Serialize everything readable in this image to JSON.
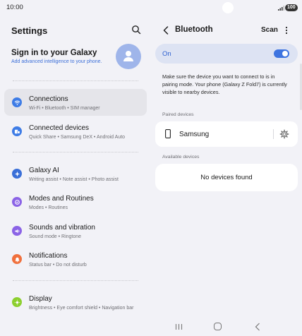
{
  "status": {
    "time": "10:00",
    "battery": "100"
  },
  "left": {
    "title": "Settings",
    "account": {
      "title": "Sign in to your Galaxy",
      "subtitle": "Add advanced intelligence to your phone."
    },
    "items": [
      {
        "title": "Connections",
        "sub": "Wi-Fi • Bluetooth • SIM manager",
        "icon": "wifi-icon",
        "color": "#3e7ce6",
        "selected": true
      },
      {
        "title": "Connected devices",
        "sub": "Quick Share • Samsung DeX • Android Auto",
        "icon": "connected-devices-icon",
        "color": "#3e7ce6"
      },
      {
        "title": "Galaxy AI",
        "sub": "Writing assist • Note assist • Photo assist",
        "icon": "galaxy-ai-icon",
        "color": "#3a6fd8"
      },
      {
        "title": "Modes and Routines",
        "sub": "Modes • Routines",
        "icon": "modes-icon",
        "color": "#8b63e6"
      },
      {
        "title": "Sounds and vibration",
        "sub": "Sound mode • Ringtone",
        "icon": "sound-icon",
        "color": "#8b63e6"
      },
      {
        "title": "Notifications",
        "sub": "Status bar • Do not disturb",
        "icon": "notification-bell-icon",
        "color": "#f0703d"
      },
      {
        "title": "Display",
        "sub": "Brightness • Eye comfort shield • Navigation bar",
        "icon": "display-sun-icon",
        "color": "#8ccf2e"
      }
    ]
  },
  "right": {
    "title": "Bluetooth",
    "scan_label": "Scan",
    "toggle": {
      "label": "On",
      "on": true
    },
    "description": "Make sure the device you want to connect to is in pairing mode. Your phone (Galaxy Z Fold7) is currently visible to nearby devices.",
    "paired_label": "Paired devices",
    "paired_devices": [
      {
        "name": "Samsung"
      }
    ],
    "available_label": "Available devices",
    "available_empty": "No devices found"
  },
  "colors": {
    "accent": "#3e74e0",
    "background": "#f2f2f7",
    "card": "#ffffff"
  }
}
